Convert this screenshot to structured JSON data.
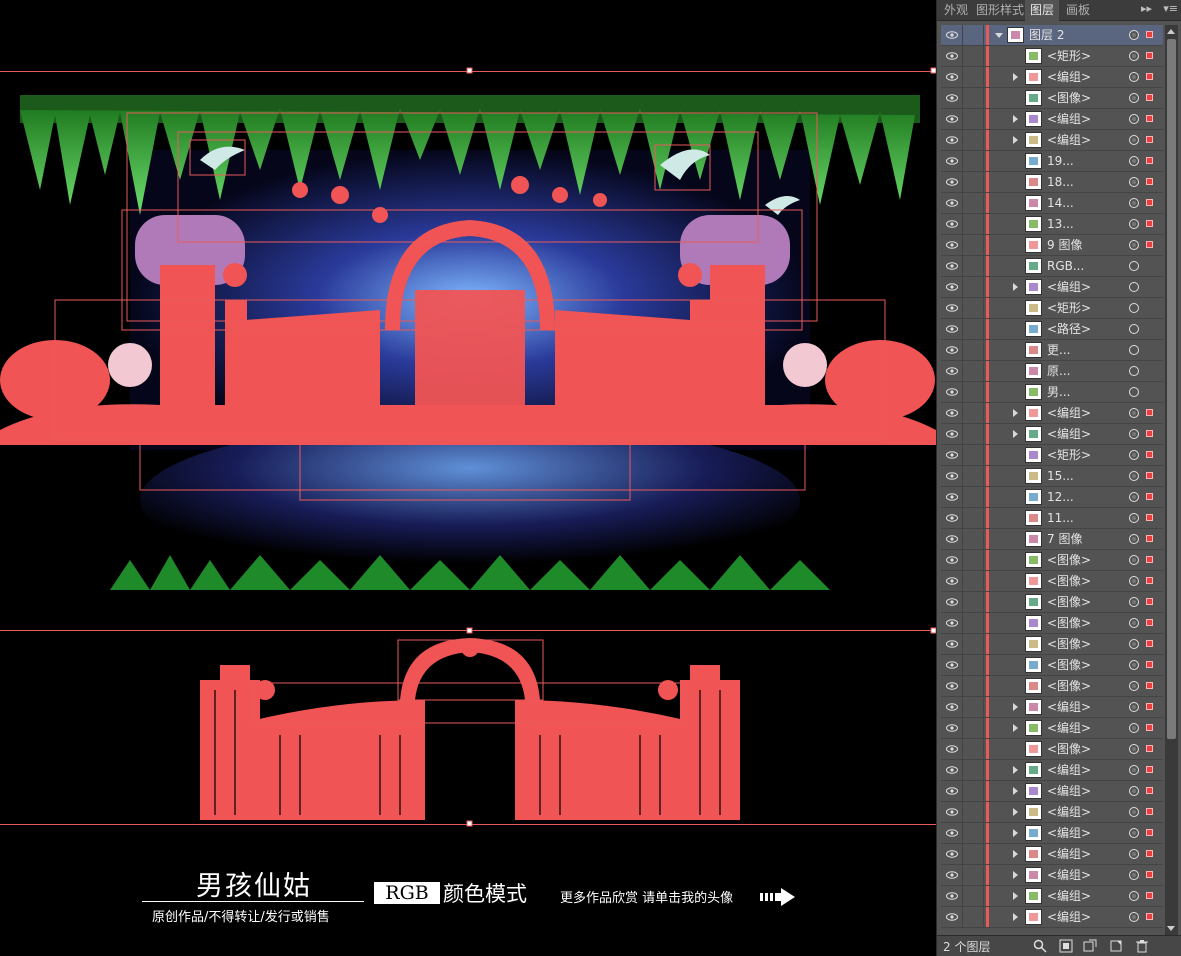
{
  "canvas": {
    "title": "男孩仙姑",
    "subtitle": "原创作品/不得转让/发行或销售",
    "rgb_label": "RGB",
    "color_mode_label": "颜色模式",
    "more_works": "更多作品欣赏 请单击我的头像"
  },
  "panel": {
    "tabs": [
      {
        "label": "外观"
      },
      {
        "label": "图形样式"
      },
      {
        "label": "图层"
      },
      {
        "label": "画板"
      }
    ],
    "active_tab": "图层",
    "top_layer": "图层 2",
    "layers": [
      {
        "label": "<矩形>",
        "expandable": false,
        "selected": true
      },
      {
        "label": "<编组>",
        "expandable": true,
        "selected": true
      },
      {
        "label": "<图像>",
        "expandable": false,
        "selected": true
      },
      {
        "label": "<编组>",
        "expandable": true,
        "selected": true
      },
      {
        "label": "<编组>",
        "expandable": true,
        "selected": true
      },
      {
        "label": "19...",
        "expandable": false,
        "selected": true
      },
      {
        "label": "18...",
        "expandable": false,
        "selected": true
      },
      {
        "label": "14...",
        "expandable": false,
        "selected": true
      },
      {
        "label": "13...",
        "expandable": false,
        "selected": true
      },
      {
        "label": "9 图像",
        "expandable": false,
        "selected": true
      },
      {
        "label": "RGB...",
        "expandable": false,
        "selected": false
      },
      {
        "label": "<编组>",
        "expandable": true,
        "selected": false
      },
      {
        "label": "<矩形>",
        "expandable": false,
        "selected": false
      },
      {
        "label": "<路径>",
        "expandable": false,
        "selected": false
      },
      {
        "label": "更...",
        "expandable": false,
        "selected": false
      },
      {
        "label": "原...",
        "expandable": false,
        "selected": false
      },
      {
        "label": "男...",
        "expandable": false,
        "selected": false
      },
      {
        "label": "<编组>",
        "expandable": true,
        "selected": true
      },
      {
        "label": "<编组>",
        "expandable": true,
        "selected": true
      },
      {
        "label": "<矩形>",
        "expandable": false,
        "selected": true
      },
      {
        "label": "15...",
        "expandable": false,
        "selected": true
      },
      {
        "label": "12...",
        "expandable": false,
        "selected": true
      },
      {
        "label": "11...",
        "expandable": false,
        "selected": true
      },
      {
        "label": "7 图像",
        "expandable": false,
        "selected": true
      },
      {
        "label": "<图像>",
        "expandable": false,
        "selected": true
      },
      {
        "label": "<图像>",
        "expandable": false,
        "selected": true
      },
      {
        "label": "<图像>",
        "expandable": false,
        "selected": true
      },
      {
        "label": "<图像>",
        "expandable": false,
        "selected": true
      },
      {
        "label": "<图像>",
        "expandable": false,
        "selected": true
      },
      {
        "label": "<图像>",
        "expandable": false,
        "selected": true
      },
      {
        "label": "<图像>",
        "expandable": false,
        "selected": true
      },
      {
        "label": "<编组>",
        "expandable": true,
        "selected": true
      },
      {
        "label": "<编组>",
        "expandable": true,
        "selected": true
      },
      {
        "label": "<图像>",
        "expandable": false,
        "selected": true
      },
      {
        "label": "<编组>",
        "expandable": true,
        "selected": true
      },
      {
        "label": "<编组>",
        "expandable": true,
        "selected": true
      },
      {
        "label": "<编组>",
        "expandable": true,
        "selected": true
      },
      {
        "label": "<编组>",
        "expandable": true,
        "selected": true
      },
      {
        "label": "<编组>",
        "expandable": true,
        "selected": true
      },
      {
        "label": "<编组>",
        "expandable": true,
        "selected": true
      },
      {
        "label": "<编组>",
        "expandable": true,
        "selected": true
      },
      {
        "label": "<编组>",
        "expandable": true,
        "selected": true
      }
    ],
    "status": "2 个图层",
    "colors": {
      "layer_color": "#e85a5a",
      "panel_bg": "#535353",
      "selection": "#e84040"
    }
  }
}
